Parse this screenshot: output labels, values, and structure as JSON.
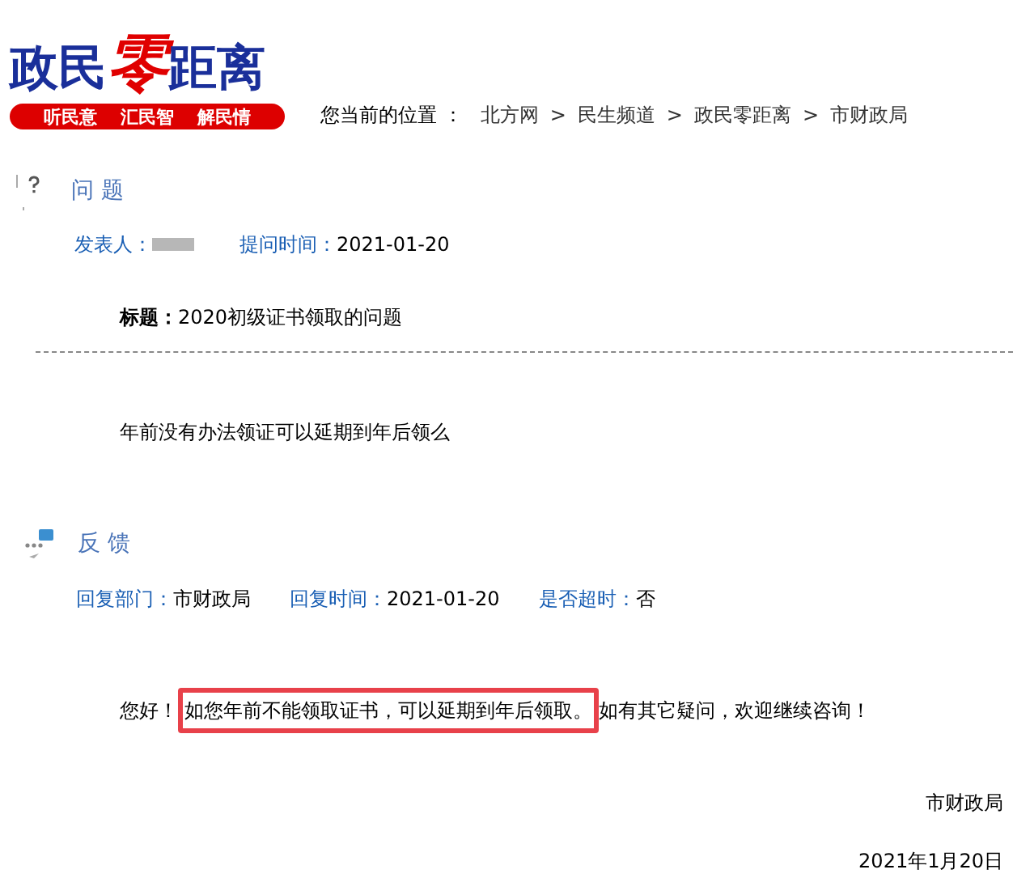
{
  "header": {
    "logo": {
      "parts": [
        "政民",
        "零",
        "距离"
      ]
    },
    "tagline": [
      "听民意",
      "汇民智",
      "解民情"
    ]
  },
  "breadcrumb": {
    "label": "您当前的位置 ：",
    "items": [
      "北方网",
      "民生频道",
      "政民零距离",
      "市财政局"
    ],
    "separators": [
      ">",
      ">",
      ">"
    ]
  },
  "question": {
    "heading": "问 题",
    "meta": [
      {
        "label": "发表人：",
        "kind": "blurred"
      },
      {
        "label": "提问时间：",
        "value": "2021-01-20",
        "kind": "text"
      }
    ],
    "title_label": "标题：",
    "title": "2020初级证书领取的问题",
    "body": "年前没有办法领证可以延期到年后领么"
  },
  "reply": {
    "heading": "反 馈",
    "meta": [
      {
        "label": "回复部门：",
        "value": "市财政局"
      },
      {
        "label": "回复时间：",
        "value": "2021-01-20"
      },
      {
        "label": "是否超时：",
        "value": "否"
      }
    ],
    "body": [
      {
        "text": "您好！",
        "highlighted": false
      },
      {
        "text": "如您年前不能领取证书，可以延期到年后领取。",
        "highlighted": true
      },
      {
        "text": "如有其它疑问，欢迎继续咨询！",
        "highlighted": false
      }
    ],
    "signature": "市财政局",
    "date": "2021年1月20日"
  }
}
